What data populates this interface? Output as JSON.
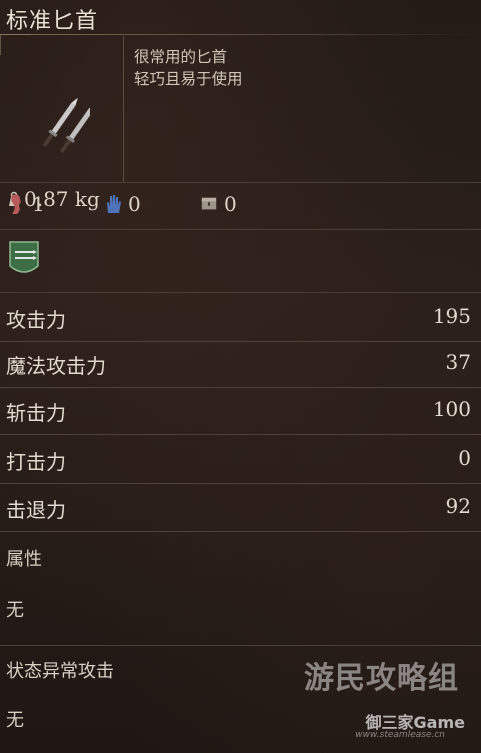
{
  "item": {
    "name": "标准匕首",
    "description": [
      "很常用的匕首",
      "轻巧且易于使用"
    ],
    "weight": "0.87 kg",
    "icon": "twin-daggers-icon"
  },
  "requirements": [
    {
      "icon": "strength-icon",
      "value": "1"
    },
    {
      "icon": "hand-icon",
      "value": "0"
    },
    {
      "icon": "chest-icon",
      "value": "0"
    }
  ],
  "effect_icon": "shield-crest-icon",
  "stats": [
    {
      "label": "攻击力",
      "value": "195"
    },
    {
      "label": "魔法攻击力",
      "value": "37"
    },
    {
      "label": "斩击力",
      "value": "100"
    },
    {
      "label": "打击力",
      "value": "0"
    },
    {
      "label": "击退力",
      "value": "92"
    }
  ],
  "attribute": {
    "label": "属性",
    "value": "无"
  },
  "status_attack": {
    "label": "状态异常攻击",
    "value": "无"
  },
  "watermark": {
    "line1": "游民攻略组",
    "line2": "御三家Game",
    "line3": "www.steamlease.cn"
  },
  "colors": {
    "text": "#e2dace",
    "background": "#211a16",
    "divider": "#4e4238"
  }
}
